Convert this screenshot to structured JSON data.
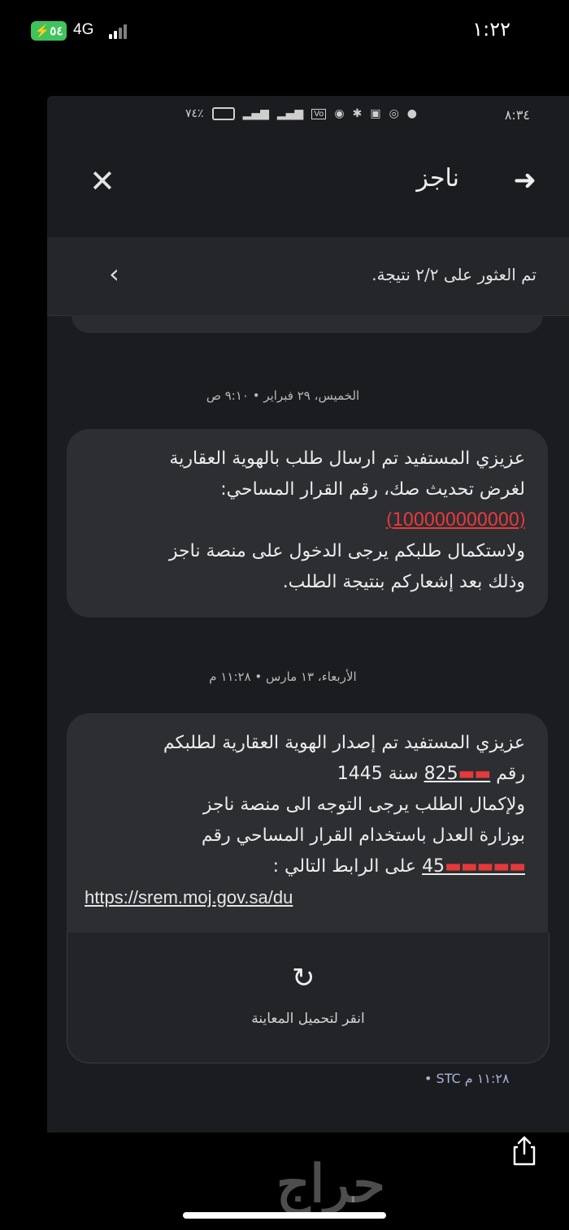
{
  "outer_status": {
    "battery": "٥٤",
    "network": "4G",
    "time": "١:٢٢"
  },
  "inner_status": {
    "time": "٨:٣٤",
    "battery": "٧٤٪"
  },
  "toolbar": {
    "title": "ناجز"
  },
  "search_results": {
    "text": "تم العثور على ٢/٢ نتيجة."
  },
  "messages": [
    {
      "date": "الخميس، ٢٩ فبراير • ٩:١٠ ص",
      "lines": [
        "عزيزي المستفيد تم ارسال طلب بالهوية العقارية",
        "لغرض تحديث صك، رقم القرار المساحي:",
        "ولاستكمال طلبكم يرجى الدخول على منصة ناجز",
        "وذلك بعد إشعاركم بنتيجة الطلب."
      ],
      "redacted": "(100000000000)"
    },
    {
      "date": "الأربعاء، ١٣ مارس • ١١:٢٨ م",
      "line1": "عزيزي المستفيد تم إصدار الهوية العقارية  لطلبكم",
      "line2_prefix": "رقم",
      "order_number": "825",
      "line2_suffix": "سنة 1445",
      "line3": "ولإكمال الطلب يرجى التوجه الى منصة ناجز",
      "line4": "بوزارة العدل باستخدام القرار المساحي رقم",
      "survey_number": "45",
      "line5_suffix": "على الرابط التالي :",
      "link": "https://srem.moj.gov.sa/du",
      "preview_label": "انقر لتحميل المعاينة",
      "meta": "١١:٢٨ م STC •"
    }
  ],
  "watermark": "حراج"
}
